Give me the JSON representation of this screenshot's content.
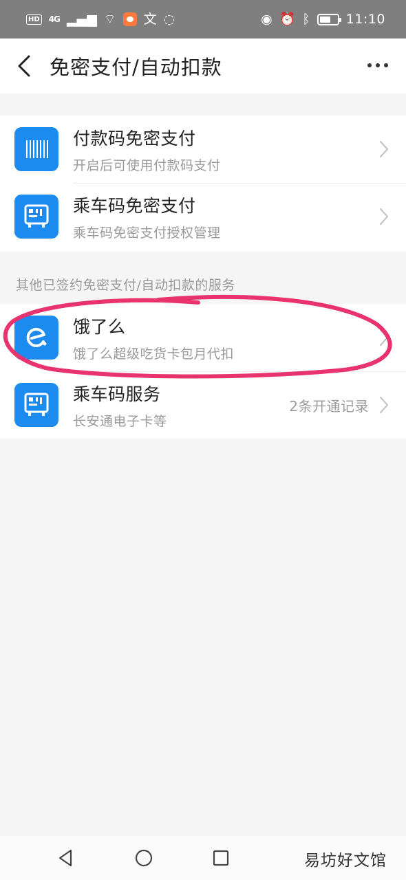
{
  "status_bar": {
    "hd": "HD",
    "network": "4G",
    "time": "11:10",
    "battery_level": 0.65
  },
  "header": {
    "title": "免密支付/自动扣款",
    "back_icon": "chevron-left-icon",
    "more_icon": "more-horizontal-icon"
  },
  "section1": {
    "items": [
      {
        "title": "付款码免密支付",
        "subtitle": "开启后可使用付款码支付",
        "icon": "barcode-icon"
      },
      {
        "title": "乘车码免密支付",
        "subtitle": "乘车码免密支付授权管理",
        "icon": "transit-qr-icon"
      }
    ]
  },
  "section2": {
    "caption": "其他已签约免密支付/自动扣款的服务",
    "items": [
      {
        "title": "饿了么",
        "subtitle": "饿了么超级吃货卡包月代扣",
        "icon": "eleme-logo-icon"
      },
      {
        "title": "乘车码服务",
        "subtitle": "长安通电子卡等",
        "extra": "2条开通记录",
        "icon": "transit-qr-icon"
      }
    ]
  },
  "watermark": "易坊好文馆",
  "colors": {
    "accent": "#1b8bf0",
    "annotation": "#e8336f",
    "status_bar": "#7f7f7f"
  }
}
